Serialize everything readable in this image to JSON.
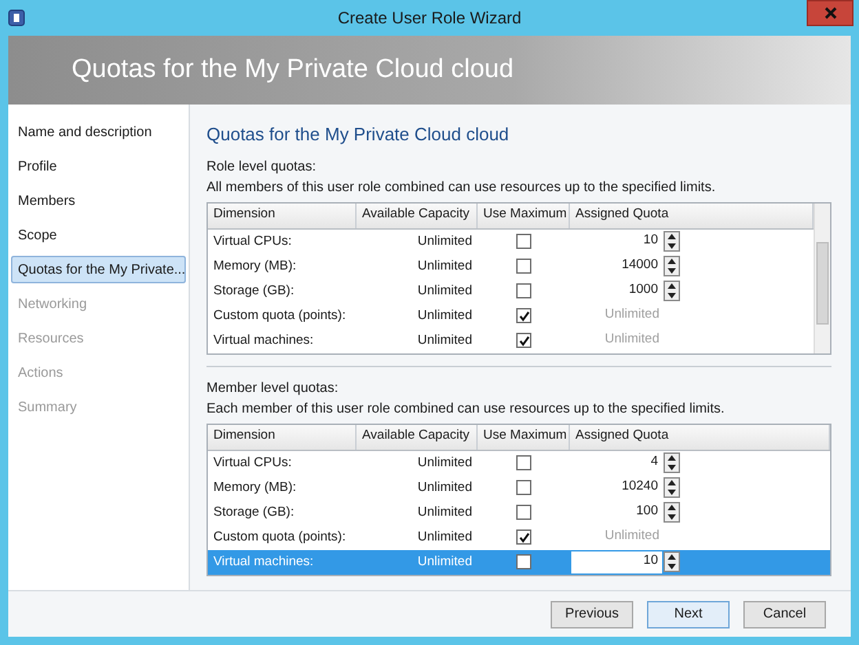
{
  "window": {
    "title": "Create User Role Wizard"
  },
  "banner": {
    "title": "Quotas for the My Private Cloud cloud"
  },
  "sidebar": {
    "items": [
      {
        "label": "Name and description",
        "selected": false,
        "disabled": false
      },
      {
        "label": "Profile",
        "selected": false,
        "disabled": false
      },
      {
        "label": "Members",
        "selected": false,
        "disabled": false
      },
      {
        "label": "Scope",
        "selected": false,
        "disabled": false
      },
      {
        "label": "Quotas for the My Private...",
        "selected": true,
        "disabled": false
      },
      {
        "label": "Networking",
        "selected": false,
        "disabled": true
      },
      {
        "label": "Resources",
        "selected": false,
        "disabled": true
      },
      {
        "label": "Actions",
        "selected": false,
        "disabled": true
      },
      {
        "label": "Summary",
        "selected": false,
        "disabled": true
      }
    ]
  },
  "page_heading": "Quotas for the My Private Cloud cloud",
  "sections": [
    {
      "title": "Role level quotas:",
      "description": "All members of this user role combined can use resources up to the specified limits.",
      "scrollbar": true,
      "columns": [
        "Dimension",
        "Available Capacity",
        "Use Maximum",
        "Assigned Quota"
      ],
      "rows": [
        {
          "dimension": "Virtual CPUs:",
          "available": "Unlimited",
          "use_maximum": false,
          "assigned": "10",
          "selected": false
        },
        {
          "dimension": "Memory (MB):",
          "available": "Unlimited",
          "use_maximum": false,
          "assigned": "14000",
          "selected": false
        },
        {
          "dimension": "Storage (GB):",
          "available": "Unlimited",
          "use_maximum": false,
          "assigned": "1000",
          "selected": false
        },
        {
          "dimension": "Custom quota (points):",
          "available": "Unlimited",
          "use_maximum": true,
          "assigned": "Unlimited",
          "selected": false
        },
        {
          "dimension": "Virtual machines:",
          "available": "Unlimited",
          "use_maximum": true,
          "assigned": "Unlimited",
          "selected": false
        }
      ]
    },
    {
      "title": "Member level quotas:",
      "description": "Each member of this user role combined can use resources up to the specified limits.",
      "scrollbar": false,
      "columns": [
        "Dimension",
        "Available Capacity",
        "Use Maximum",
        "Assigned Quota"
      ],
      "rows": [
        {
          "dimension": "Virtual CPUs:",
          "available": "Unlimited",
          "use_maximum": false,
          "assigned": "4",
          "selected": false
        },
        {
          "dimension": "Memory (MB):",
          "available": "Unlimited",
          "use_maximum": false,
          "assigned": "10240",
          "selected": false
        },
        {
          "dimension": "Storage (GB):",
          "available": "Unlimited",
          "use_maximum": false,
          "assigned": "100",
          "selected": false
        },
        {
          "dimension": "Custom quota (points):",
          "available": "Unlimited",
          "use_maximum": true,
          "assigned": "Unlimited",
          "selected": false
        },
        {
          "dimension": "Virtual machines:",
          "available": "Unlimited",
          "use_maximum": false,
          "assigned": "10",
          "selected": true
        }
      ]
    }
  ],
  "buttons": [
    {
      "label": "Previous",
      "default": false
    },
    {
      "label": "Next",
      "default": true
    },
    {
      "label": "Cancel",
      "default": false
    }
  ]
}
